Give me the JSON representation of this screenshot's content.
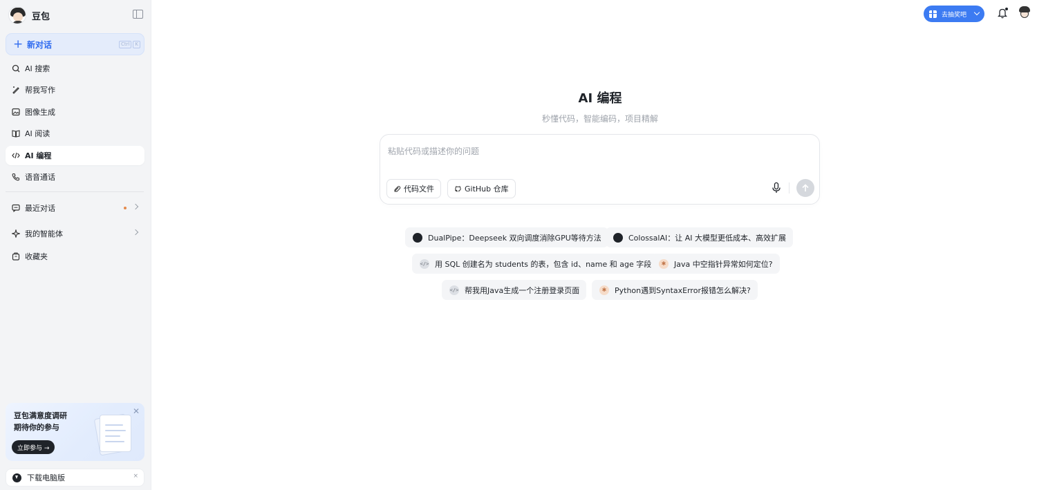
{
  "brand": {
    "name": "豆包"
  },
  "new_chat": {
    "label": "新对话",
    "kbd": [
      "Ctrl",
      "K"
    ]
  },
  "nav": [
    {
      "label": "AI 搜索",
      "icon": "search-icon"
    },
    {
      "label": "帮我写作",
      "icon": "pen-icon"
    },
    {
      "label": "图像生成",
      "icon": "image-icon"
    },
    {
      "label": "AI 阅读",
      "icon": "book-icon"
    },
    {
      "label": "AI 编程",
      "icon": "code-icon",
      "active": true
    },
    {
      "label": "语音通话",
      "icon": "phone-icon"
    }
  ],
  "nav2": [
    {
      "label": "最近对话",
      "icon": "chat-icon"
    },
    {
      "label": "我的智能体",
      "icon": "sparkle-icon"
    },
    {
      "label": "收藏夹",
      "icon": "bookmark-icon"
    }
  ],
  "survey": {
    "line1": "豆包满意度调研",
    "line2": "期待你的参与",
    "button": "立即参与 →",
    "close": "✕"
  },
  "download": {
    "label": "下载电脑版",
    "close": "×"
  },
  "header": {
    "gift_label": "去抽奖吧"
  },
  "main": {
    "title": "AI 编程",
    "subtitle": "秒懂代码，智能编码，项目精解",
    "input_placeholder": "粘贴代码或描述你的问题",
    "attach_label": "代码文件",
    "github_label": "GitHub 仓库"
  },
  "suggestions": [
    {
      "text": "DualPipe：Deepseek 双向调度消除GPU等待方法",
      "icon": "github-icon"
    },
    {
      "text": "ColossalAI：让 AI 大模型更低成本、高效扩展",
      "icon": "github-icon"
    },
    {
      "text": "用 SQL 创建名为 students 的表，包含 id、name 和 age 字段",
      "icon": "code-icon"
    },
    {
      "text": "Java 中空指针异常如何定位?",
      "icon": "bug-icon"
    },
    {
      "text": "帮我用Java生成一个注册登录页面",
      "icon": "code-icon"
    },
    {
      "text": "Python遇到SyntaxError报错怎么解决?",
      "icon": "bug-icon"
    }
  ],
  "colors": {
    "accent": "#2f6bef",
    "sidebar_bg": "#f3f4f6",
    "gift_bg": "#3c7bf2"
  }
}
